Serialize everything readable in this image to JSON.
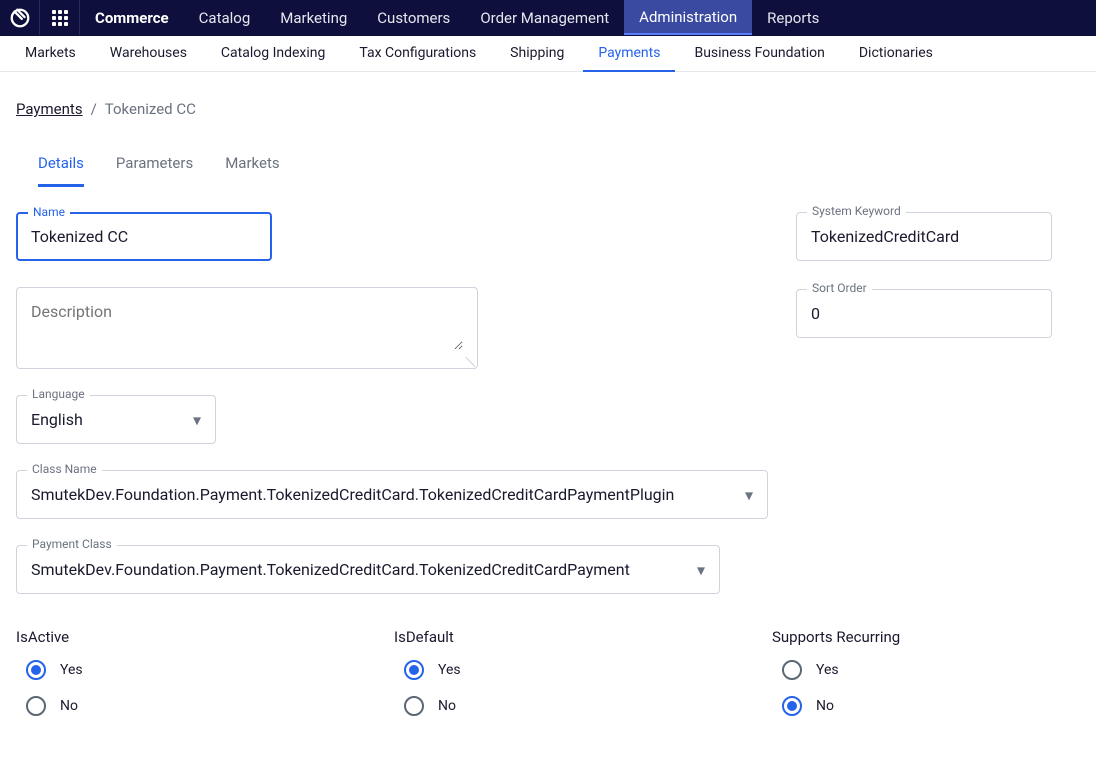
{
  "topNav": {
    "items": [
      {
        "label": "Commerce",
        "active": true
      },
      {
        "label": "Catalog"
      },
      {
        "label": "Marketing"
      },
      {
        "label": "Customers"
      },
      {
        "label": "Order Management"
      },
      {
        "label": "Administration",
        "selected": true
      },
      {
        "label": "Reports"
      }
    ]
  },
  "subNav": {
    "items": [
      {
        "label": "Markets"
      },
      {
        "label": "Warehouses"
      },
      {
        "label": "Catalog Indexing"
      },
      {
        "label": "Tax Configurations"
      },
      {
        "label": "Shipping"
      },
      {
        "label": "Payments",
        "active": true
      },
      {
        "label": "Business Foundation"
      },
      {
        "label": "Dictionaries"
      }
    ]
  },
  "breadcrumb": {
    "parent": "Payments",
    "current": "Tokenized CC"
  },
  "tabs": [
    {
      "label": "Details",
      "active": true
    },
    {
      "label": "Parameters"
    },
    {
      "label": "Markets"
    }
  ],
  "fields": {
    "name": {
      "label": "Name",
      "value": "Tokenized CC"
    },
    "description": {
      "placeholder": "Description",
      "value": ""
    },
    "language": {
      "label": "Language",
      "value": "English"
    },
    "className": {
      "label": "Class Name",
      "value": "SmutekDev.Foundation.Payment.TokenizedCreditCard.TokenizedCreditCardPaymentPlugin"
    },
    "paymentClass": {
      "label": "Payment Class",
      "value": "SmutekDev.Foundation.Payment.TokenizedCreditCard.TokenizedCreditCardPayment"
    },
    "systemKeyword": {
      "label": "System Keyword",
      "value": "TokenizedCreditCard"
    },
    "sortOrder": {
      "label": "Sort Order",
      "value": "0"
    }
  },
  "radios": {
    "isActive": {
      "title": "IsActive",
      "options": [
        "Yes",
        "No"
      ],
      "selected": "Yes"
    },
    "isDefault": {
      "title": "IsDefault",
      "options": [
        "Yes",
        "No"
      ],
      "selected": "Yes"
    },
    "supportsRecurring": {
      "title": "Supports Recurring",
      "options": [
        "Yes",
        "No"
      ],
      "selected": "No"
    }
  }
}
